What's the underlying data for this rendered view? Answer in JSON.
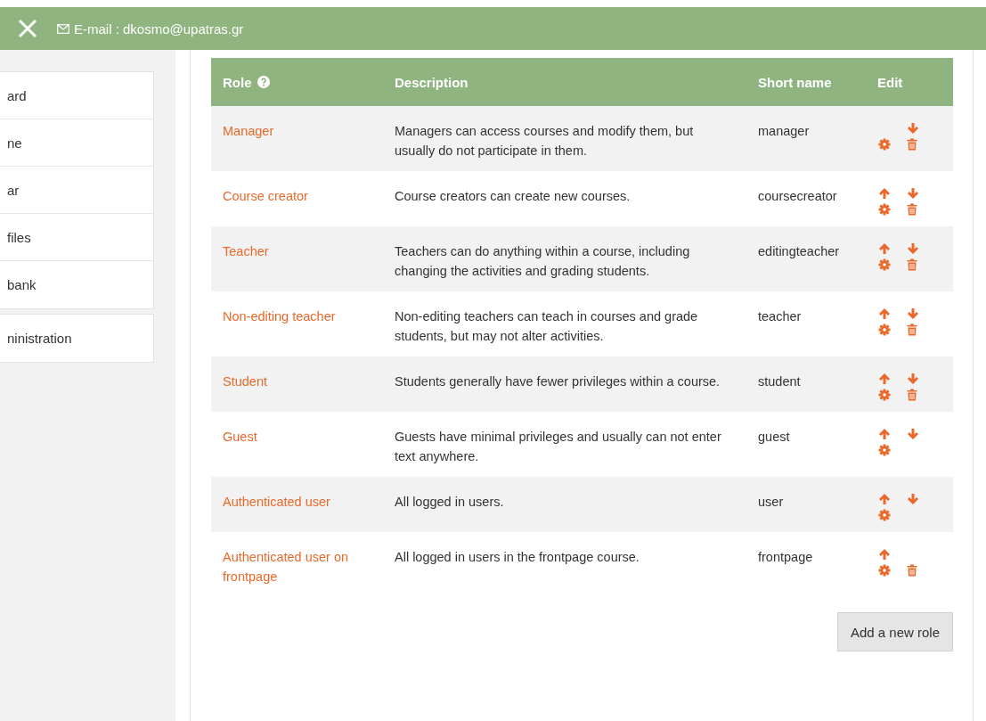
{
  "top_bar": {
    "email": "E-mail : dkosmo@upatras.gr"
  },
  "sidebar": {
    "groups": [
      {
        "items": [
          "ard",
          "ne",
          "ar",
          "files",
          "bank"
        ]
      },
      {
        "items": [
          "ninistration"
        ]
      }
    ]
  },
  "table": {
    "columns": [
      {
        "label": "Role",
        "help": true
      },
      {
        "label": "Description",
        "help": false
      },
      {
        "label": "Short name",
        "help": false
      },
      {
        "label": "Edit",
        "help": false
      }
    ],
    "rows": [
      {
        "role": "Manager",
        "description": "Managers can access courses and modify them, but usually do not participate in them.",
        "short_name": "manager",
        "move_up": false,
        "move_down": true,
        "delete": true
      },
      {
        "role": "Course creator",
        "description": "Course creators can create new courses.",
        "short_name": "coursecreator",
        "move_up": true,
        "move_down": true,
        "delete": true
      },
      {
        "role": "Teacher",
        "description": "Teachers can do anything within a course, including changing the activities and grading students.",
        "short_name": "editingteacher",
        "move_up": true,
        "move_down": true,
        "delete": true
      },
      {
        "role": "Non-editing teacher",
        "description": "Non-editing teachers can teach in courses and grade students, but may not alter activities.",
        "short_name": "teacher",
        "move_up": true,
        "move_down": true,
        "delete": true
      },
      {
        "role": "Student",
        "description": "Students generally have fewer privileges within a course.",
        "short_name": "student",
        "move_up": true,
        "move_down": true,
        "delete": true
      },
      {
        "role": "Guest",
        "description": "Guests have minimal privileges and usually can not enter text anywhere.",
        "short_name": "guest",
        "move_up": true,
        "move_down": true,
        "delete": false
      },
      {
        "role": "Authenticated user",
        "description": "All logged in users.",
        "short_name": "user",
        "move_up": true,
        "move_down": true,
        "delete": false
      },
      {
        "role": "Authenticated user on frontpage",
        "description": "All logged in users in the frontpage course.",
        "short_name": "frontpage",
        "move_up": true,
        "move_down": false,
        "delete": true
      }
    ]
  },
  "add_button": "Add a new role"
}
